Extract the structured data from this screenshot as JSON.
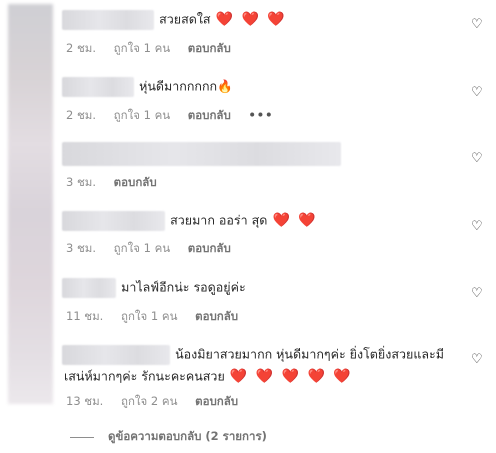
{
  "comments": [
    {
      "text": "สวยสดใส",
      "hearts": "❤️ ❤️ ❤️",
      "time": "2 ชม.",
      "likes": "ถูกใจ 1 คน",
      "reply": "ตอบกลับ"
    },
    {
      "text": "หุ่นดีมากกกกก🔥",
      "time": "2 ชม.",
      "likes": "ถูกใจ 1 คน",
      "reply": "ตอบกลับ",
      "more": "•••"
    },
    {
      "text": "",
      "time": "3 ชม.",
      "reply": "ตอบกลับ"
    },
    {
      "text": "สวยมาก ออร่า สุด",
      "hearts": "❤️ ❤️",
      "time": "3 ชม.",
      "likes": "ถูกใจ 1 คน",
      "reply": "ตอบกลับ"
    },
    {
      "text": "มาไลฟ์อีกน่ะ รอดูอยู่ค่ะ",
      "time": "11 ชม.",
      "likes": "ถูกใจ 1 คน",
      "reply": "ตอบกลับ"
    },
    {
      "line1": "น้องมิยาสวยมากก หุ่นดีมากๆค่ะ ยิ่งโตยิ่งสวยและมี",
      "line2": "เสน่ห์มากๆค่ะ รักนะคะคนสวย",
      "hearts": "❤️ ❤️ ❤️ ❤️ ❤️",
      "time": "13 ชม.",
      "likes": "ถูกใจ 2 คน",
      "reply": "ตอบกลับ"
    }
  ],
  "view_replies": "ดูข้อความตอบกลับ (2 รายการ)",
  "icons": {
    "like": "heart-outline-icon"
  }
}
